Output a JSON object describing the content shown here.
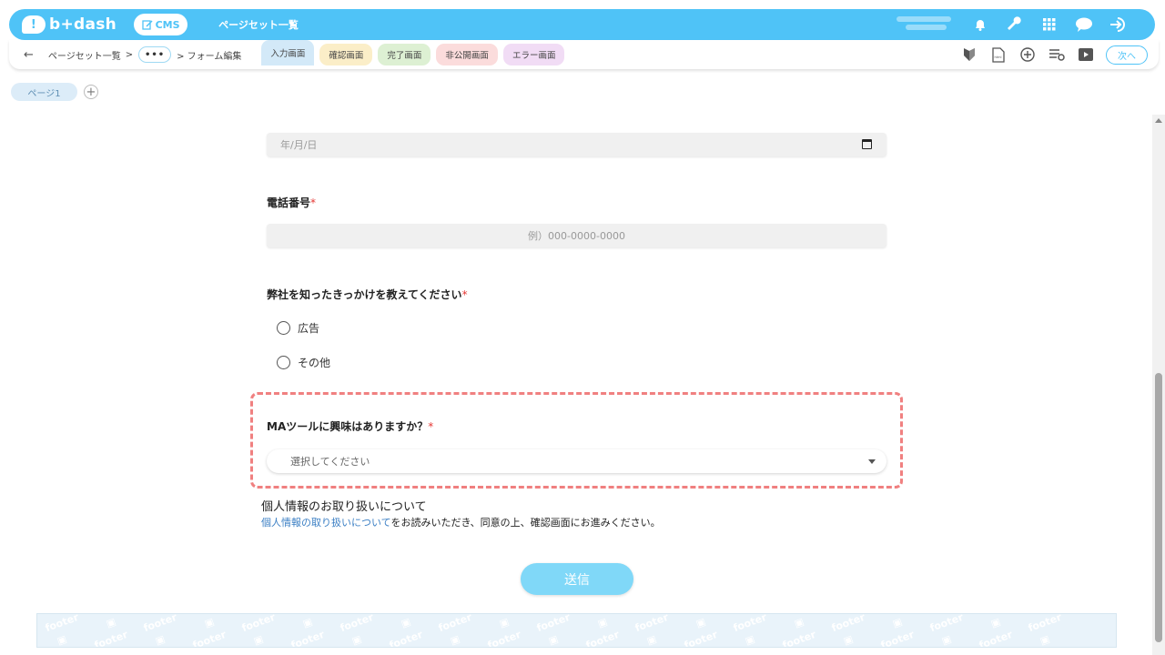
{
  "header": {
    "logo_text": "b+dash",
    "cms_label": "CMS",
    "page_title": "ページセット一覧",
    "icons": [
      "bell-icon",
      "wrench-icon",
      "grid-icon",
      "chat-icon",
      "logout-icon"
    ]
  },
  "subbar": {
    "breadcrumb_root": "ページセット一覧",
    "breadcrumb_sep": ">",
    "breadcrumb_more": "•••",
    "breadcrumb_current": "> フォーム編集",
    "tabs": [
      {
        "label": "入力画面",
        "color": "#d3e9f8"
      },
      {
        "label": "確認画面",
        "color": "#fbeec8"
      },
      {
        "label": "完了画面",
        "color": "#ddf0d3"
      },
      {
        "label": "非公開画面",
        "color": "#fbdcdc"
      },
      {
        "label": "エラー画面",
        "color": "#f1dcf5"
      }
    ],
    "icons": [
      "shield-icon",
      "html-file-icon",
      "add-circle-icon",
      "list-settings-icon",
      "play-icon"
    ],
    "next_label": "次へ"
  },
  "pages": {
    "tab_label": "ページ1",
    "add_label": "+"
  },
  "form": {
    "date_placeholder": "年/月/日",
    "phone_label": "電話番号",
    "phone_placeholder": "例）000-0000-0000",
    "source_label": "弊社を知ったきっかけを教えてください",
    "source_options": [
      "広告",
      "その他"
    ],
    "ma_label": "MAツールに興味はありますか？",
    "ma_select_placeholder": "選択してください",
    "required_mark": "*",
    "privacy_title": "個人情報のお取り扱いについて",
    "privacy_link": "個人情報の取り扱いについて",
    "privacy_text": "をお読みいただき、同意の上、確認画面にお進みください。",
    "submit_label": "送信"
  },
  "footer": {
    "watermark": "footer"
  },
  "colors": {
    "brand": "#4fc3f7",
    "highlight_border": "#f08080",
    "submit": "#80d8f8",
    "required": "#e53935"
  }
}
